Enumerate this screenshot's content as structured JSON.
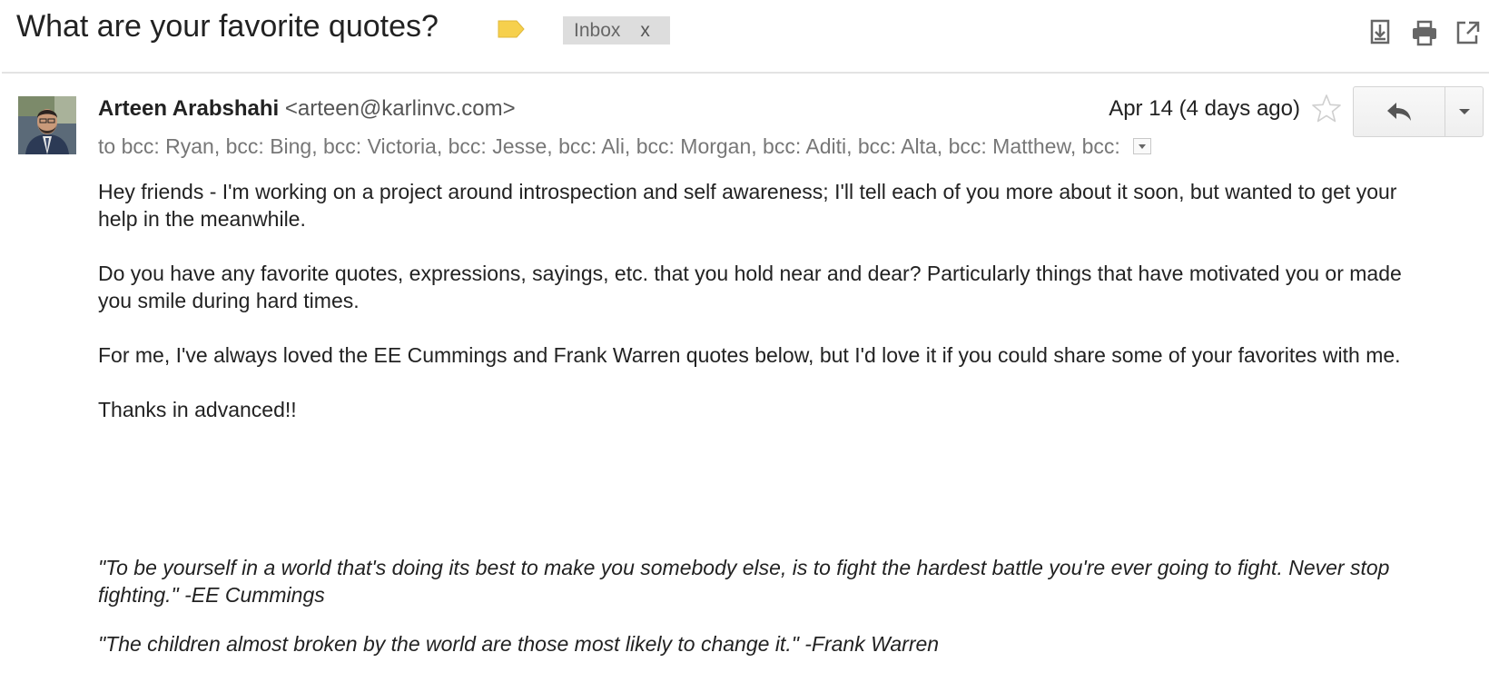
{
  "subject": {
    "title": "What are your favorite quotes?",
    "label_color": "#F6D04D",
    "inbox_chip": {
      "label": "Inbox",
      "close": "x"
    }
  },
  "header_actions": {
    "icons": [
      "download-icon",
      "print-icon",
      "open-in-new-window-icon"
    ]
  },
  "message": {
    "sender_name": "Arteen Arabshahi",
    "sender_email": "<arteen@karlinvc.com>",
    "recipients": "to bcc: Ryan, bcc: Bing, bcc: Victoria, bcc: Jesse, bcc: Ali, bcc: Morgan, bcc: Aditi, bcc: Alta, bcc: Matthew, bcc:",
    "date": "Apr 14 (4 days ago)",
    "starred": false
  },
  "body": {
    "paragraphs": [
      "Hey friends - I'm working on a project around introspection and self awareness; I'll tell each of you more about it soon, but wanted to get your help in the meanwhile.",
      "Do you have any favorite quotes, expressions, sayings, etc. that you hold near and dear? Particularly things that have motivated you or made you smile during hard times.",
      "For me, I've always loved the EE Cummings and Frank Warren quotes below, but I'd love it if you could share some of your favorites with me.",
      "Thanks in advanced!!"
    ],
    "quotes": [
      "\"To be yourself in a world that's doing its best to make you somebody else, is to fight the hardest battle you're ever going to fight. Never stop fighting.\" -EE Cummings",
      "\"The children almost broken by the world are those most likely to change it.\" -Frank Warren"
    ]
  }
}
